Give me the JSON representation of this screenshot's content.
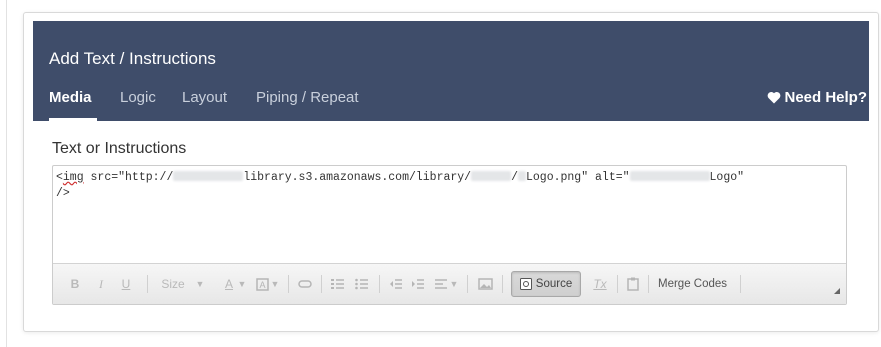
{
  "dialog": {
    "title": "Add Text / Instructions",
    "tabs": [
      {
        "label": "Media",
        "active": true
      },
      {
        "label": "Logic",
        "active": false
      },
      {
        "label": "Layout",
        "active": false
      },
      {
        "label": "Piping / Repeat",
        "active": false
      }
    ],
    "help_label": "Need Help?"
  },
  "section": {
    "label": "Text or Instructions"
  },
  "editor": {
    "code_parts": {
      "tag": "img",
      "p1": " src=\"http://",
      "p2": "library.s3.amazonaws.com/library/",
      "p3": "/",
      "p4": "Logo.png\" alt=\"",
      "p5": "Logo\"",
      "p6": "/>"
    },
    "toolbar": {
      "bold": "B",
      "italic": "I",
      "underline": "U",
      "size": "Size",
      "text_color": "A",
      "source": "Source",
      "clear_format": "Tx",
      "merge_codes": "Merge Codes"
    }
  },
  "colors": {
    "header_bg": "#3f4d6a",
    "header_text": "#ffffff",
    "inactive_tab": "#c9d0dc"
  }
}
